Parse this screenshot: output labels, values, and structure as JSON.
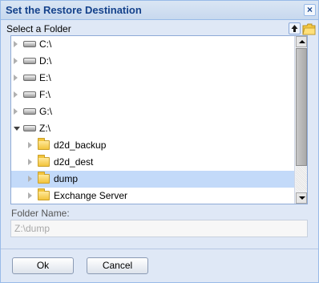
{
  "dialog": {
    "title": "Set the Restore Destination",
    "close_glyph": "×"
  },
  "tree_header": {
    "label": "Select a Folder",
    "up_icon": "up-arrow-icon",
    "new_folder_icon": "new-folder-icon"
  },
  "tree": {
    "nodes": [
      {
        "label": "C:\\",
        "type": "drive",
        "expanded": false
      },
      {
        "label": "D:\\",
        "type": "drive",
        "expanded": false
      },
      {
        "label": "E:\\",
        "type": "drive",
        "expanded": false
      },
      {
        "label": "F:\\",
        "type": "drive",
        "expanded": false
      },
      {
        "label": "G:\\",
        "type": "drive",
        "expanded": false
      },
      {
        "label": "Z:\\",
        "type": "drive",
        "expanded": true
      },
      {
        "label": "d2d_backup",
        "type": "folder",
        "expanded": false
      },
      {
        "label": "d2d_dest",
        "type": "folder",
        "expanded": false
      },
      {
        "label": "dump",
        "type": "folder",
        "expanded": false,
        "selected": true
      },
      {
        "label": "Exchange Server",
        "type": "folder",
        "expanded": false
      }
    ]
  },
  "folder_name": {
    "label": "Folder Name:",
    "value": "Z:\\dump"
  },
  "buttons": {
    "ok": "Ok",
    "cancel": "Cancel"
  },
  "colors": {
    "title_text": "#15428b",
    "dialog_bg": "#dfe8f6",
    "selected_row": "#c3daf9"
  }
}
